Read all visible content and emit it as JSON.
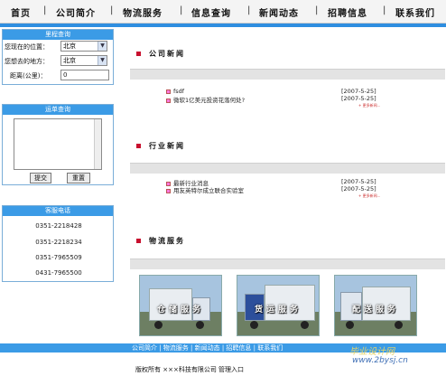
{
  "topnav": {
    "items": [
      "首页",
      "公司简介",
      "物流服务",
      "信息查询",
      "新闻动态",
      "招聘信息",
      "联系我们"
    ],
    "separator": "|"
  },
  "route_query": {
    "title": "里程查询",
    "current_label": "您现在的位置：",
    "current_value": "北京",
    "dest_label": "您想去的地方：",
    "dest_value": "北京",
    "distance_label": "距离(公里)：",
    "distance_value": "0"
  },
  "waybill_query": {
    "title": "运单查询",
    "submit_label": "提交",
    "reset_label": "重置"
  },
  "service_phone": {
    "title": "客服电话",
    "numbers": [
      "0351-2218428",
      "0351-2218234",
      "0351-7965509",
      "0431-7965500"
    ]
  },
  "company_news": {
    "title": "公司新闻",
    "items": [
      {
        "title": "fsdf",
        "date": "[2007-5-25]"
      },
      {
        "title": "微软1亿美元投资花落何处?",
        "date": "[2007-5-25]"
      }
    ],
    "more": "+ 更多新闻..."
  },
  "industry_news": {
    "title": "行业新闻",
    "items": [
      {
        "title": "最新行业消息",
        "date": "[2007-5-25]"
      },
      {
        "title": "用友英特尔成立联合实验室",
        "date": "[2007-5-25]"
      }
    ],
    "more": "+ 更多新闻..."
  },
  "logistics": {
    "title": "物流服务",
    "services": [
      "仓储服务",
      "货运服务",
      "配送服务"
    ]
  },
  "footer": {
    "links": "公司简介 | 物流服务 | 新闻动态 | 招聘信息 | 联系我们",
    "copyright": "版权所有  ×××科技有限公司  管理入口",
    "watermark": "毕业设计网",
    "watermark_url": "www.2bysj.cn"
  },
  "colors": {
    "accent_blue": "#3b9be6",
    "bullet_red": "#c8102e",
    "band_grey": "#e3e3e3"
  }
}
